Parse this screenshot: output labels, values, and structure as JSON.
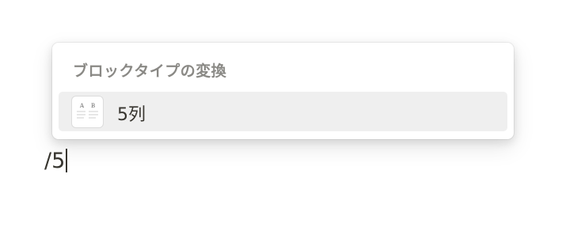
{
  "menu": {
    "header": "ブロックタイプの変換",
    "items": [
      {
        "label": "5列",
        "icon": "columns-icon",
        "icon_letters": [
          "A",
          "B"
        ],
        "selected": true
      }
    ]
  },
  "editor": {
    "typed_text": "/5"
  },
  "colors": {
    "header_text": "#8a8985",
    "item_text": "#37352f",
    "selected_bg": "#efefef"
  }
}
